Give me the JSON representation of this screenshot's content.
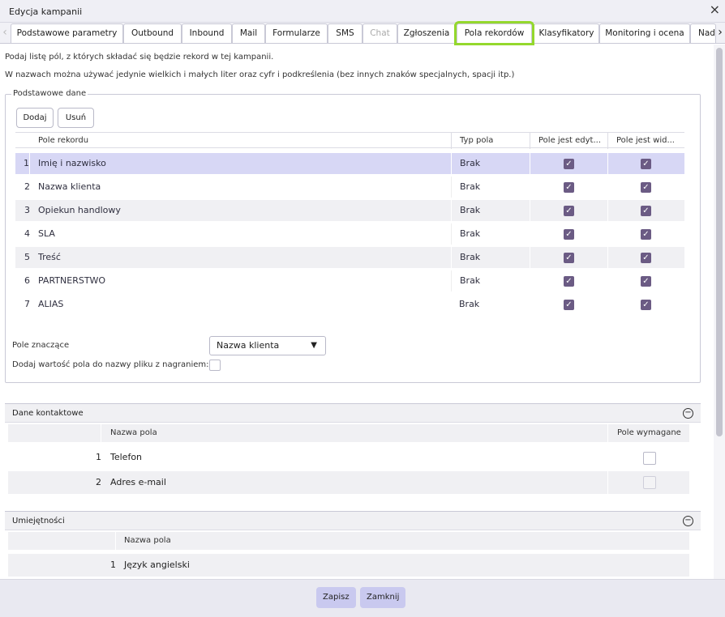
{
  "window": {
    "title": "Edycja kampanii",
    "close_icon": "close-icon"
  },
  "tabs": [
    {
      "label": "Podstawowe parametry"
    },
    {
      "label": "Outbound"
    },
    {
      "label": "Inbound"
    },
    {
      "label": "Mail"
    },
    {
      "label": "Formularze"
    },
    {
      "label": "SMS"
    },
    {
      "label": "Chat"
    },
    {
      "label": "Zgłoszenia"
    },
    {
      "label": "Pola rekordów"
    },
    {
      "label": "Klasyfikatory"
    },
    {
      "label": "Monitoring i ocena"
    },
    {
      "label": "Nad"
    }
  ],
  "active_tab": "Pola rekordów",
  "highlight_color": "#94d82d",
  "info": {
    "line1": "Podaj listę pól, z których składać się będzie rekord w tej kampanii.",
    "line2": "W nazwach można używać jedynie wielkich i małych liter oraz cyfr i podkreślenia (bez innych znaków specjalnych, spacji itp.)"
  },
  "basic": {
    "legend": "Podstawowe dane",
    "add_label": "Dodaj",
    "remove_label": "Usuń",
    "columns": [
      "Pole rekordu",
      "Typ pola",
      "Pole jest edyt...",
      "Pole jest wid..."
    ],
    "rows": [
      {
        "num": "1",
        "name": "Imię i nazwisko",
        "type": "Brak"
      },
      {
        "num": "2",
        "name": "Nazwa klienta",
        "type": "Brak"
      },
      {
        "num": "3",
        "name": "Opiekun handlowy",
        "type": "Brak"
      },
      {
        "num": "4",
        "name": "SLA",
        "type": "Brak"
      },
      {
        "num": "5",
        "name": "Treść",
        "type": "Brak"
      },
      {
        "num": "6",
        "name": "PARTNERSTWO",
        "type": "Brak"
      },
      {
        "num": "7",
        "name": "ALIAS",
        "type": "Brak"
      }
    ],
    "significant_label": "Pole znaczące",
    "significant_value": "Nazwa klienta",
    "add_to_filename_label": "Dodaj wartość pola do nazwy pliku z nagraniem:"
  },
  "contact": {
    "header": "Dane kontaktowe",
    "col_name": "Nazwa pola",
    "col_required": "Pole wymagane",
    "rows": [
      {
        "num": "1",
        "name": "Telefon"
      },
      {
        "num": "2",
        "name": "Adres e-mail"
      }
    ]
  },
  "skills": {
    "header": "Umiejętności",
    "col_name": "Nazwa pola",
    "rows": [
      {
        "num": "1",
        "name": "Język angielski"
      }
    ]
  },
  "footer": {
    "save_label": "Zapisz",
    "close_label": "Zamknij"
  }
}
